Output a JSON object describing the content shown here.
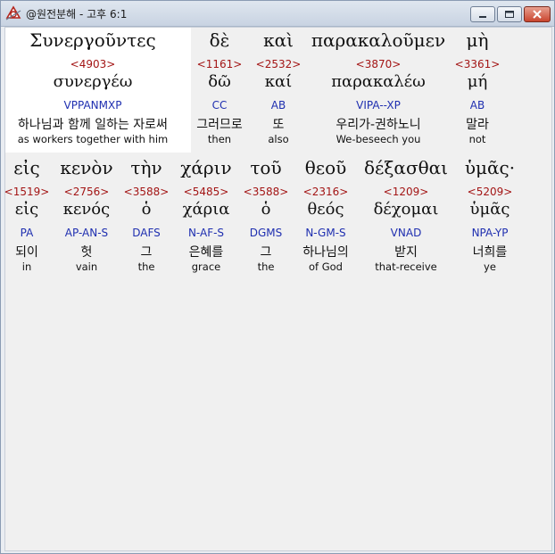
{
  "window": {
    "title": "@원전분해 - 고후 6:1"
  },
  "rows": [
    [
      {
        "greek": "Συνεργοῦντες",
        "strong": "<4903>",
        "lemma": "συνεργέω",
        "parse": "VPPANMXP",
        "korean": "하나님과 함께 일하는 자로써",
        "english": "as workers together with him"
      },
      {
        "greek": "δὲ",
        "strong": "<1161>",
        "lemma": "δῶ",
        "parse": "CC",
        "korean": "그러므로",
        "english": "then"
      },
      {
        "greek": "καὶ",
        "strong": "<2532>",
        "lemma": "καί",
        "parse": "AB",
        "korean": "또",
        "english": "also"
      },
      {
        "greek": "παρακαλοῦμεν",
        "strong": "<3870>",
        "lemma": "παρακαλέω",
        "parse": "VIPA--XP",
        "korean": "우리가-권하노니",
        "english": "We-beseech you"
      },
      {
        "greek": "μὴ",
        "strong": "<3361>",
        "lemma": "μή",
        "parse": "AB",
        "korean": "말라",
        "english": "not"
      }
    ],
    [
      {
        "greek": "εἰς",
        "strong": "<1519>",
        "lemma": "εἰς",
        "parse": "PA",
        "korean": "되이",
        "english": "in"
      },
      {
        "greek": "κενὸν",
        "strong": "<2756>",
        "lemma": "κενός",
        "parse": "AP-AN-S",
        "korean": "헛",
        "english": "vain"
      },
      {
        "greek": "τὴν",
        "strong": "<3588>",
        "lemma": "ὁ",
        "parse": "DAFS",
        "korean": "그",
        "english": "the"
      },
      {
        "greek": "χάριν",
        "strong": "<5485>",
        "lemma": "χάρια",
        "parse": "N-AF-S",
        "korean": "은혜를",
        "english": "grace"
      },
      {
        "greek": "τοῦ",
        "strong": "<3588>",
        "lemma": "ὁ",
        "parse": "DGMS",
        "korean": "그",
        "english": "the"
      },
      {
        "greek": "θεοῦ",
        "strong": "<2316>",
        "lemma": "θεός",
        "parse": "N-GM-S",
        "korean": "하나님의",
        "english": "of God"
      },
      {
        "greek": "δέξασθαι",
        "strong": "<1209>",
        "lemma": "δέχομαι",
        "parse": "VNAD",
        "korean": "받지",
        "english": "that-receive"
      },
      {
        "greek": "ὑμᾶς·",
        "strong": "<5209>",
        "lemma": "ὑμᾶς",
        "parse": "NPA-YP",
        "korean": "너희를",
        "english": "ye"
      }
    ]
  ]
}
